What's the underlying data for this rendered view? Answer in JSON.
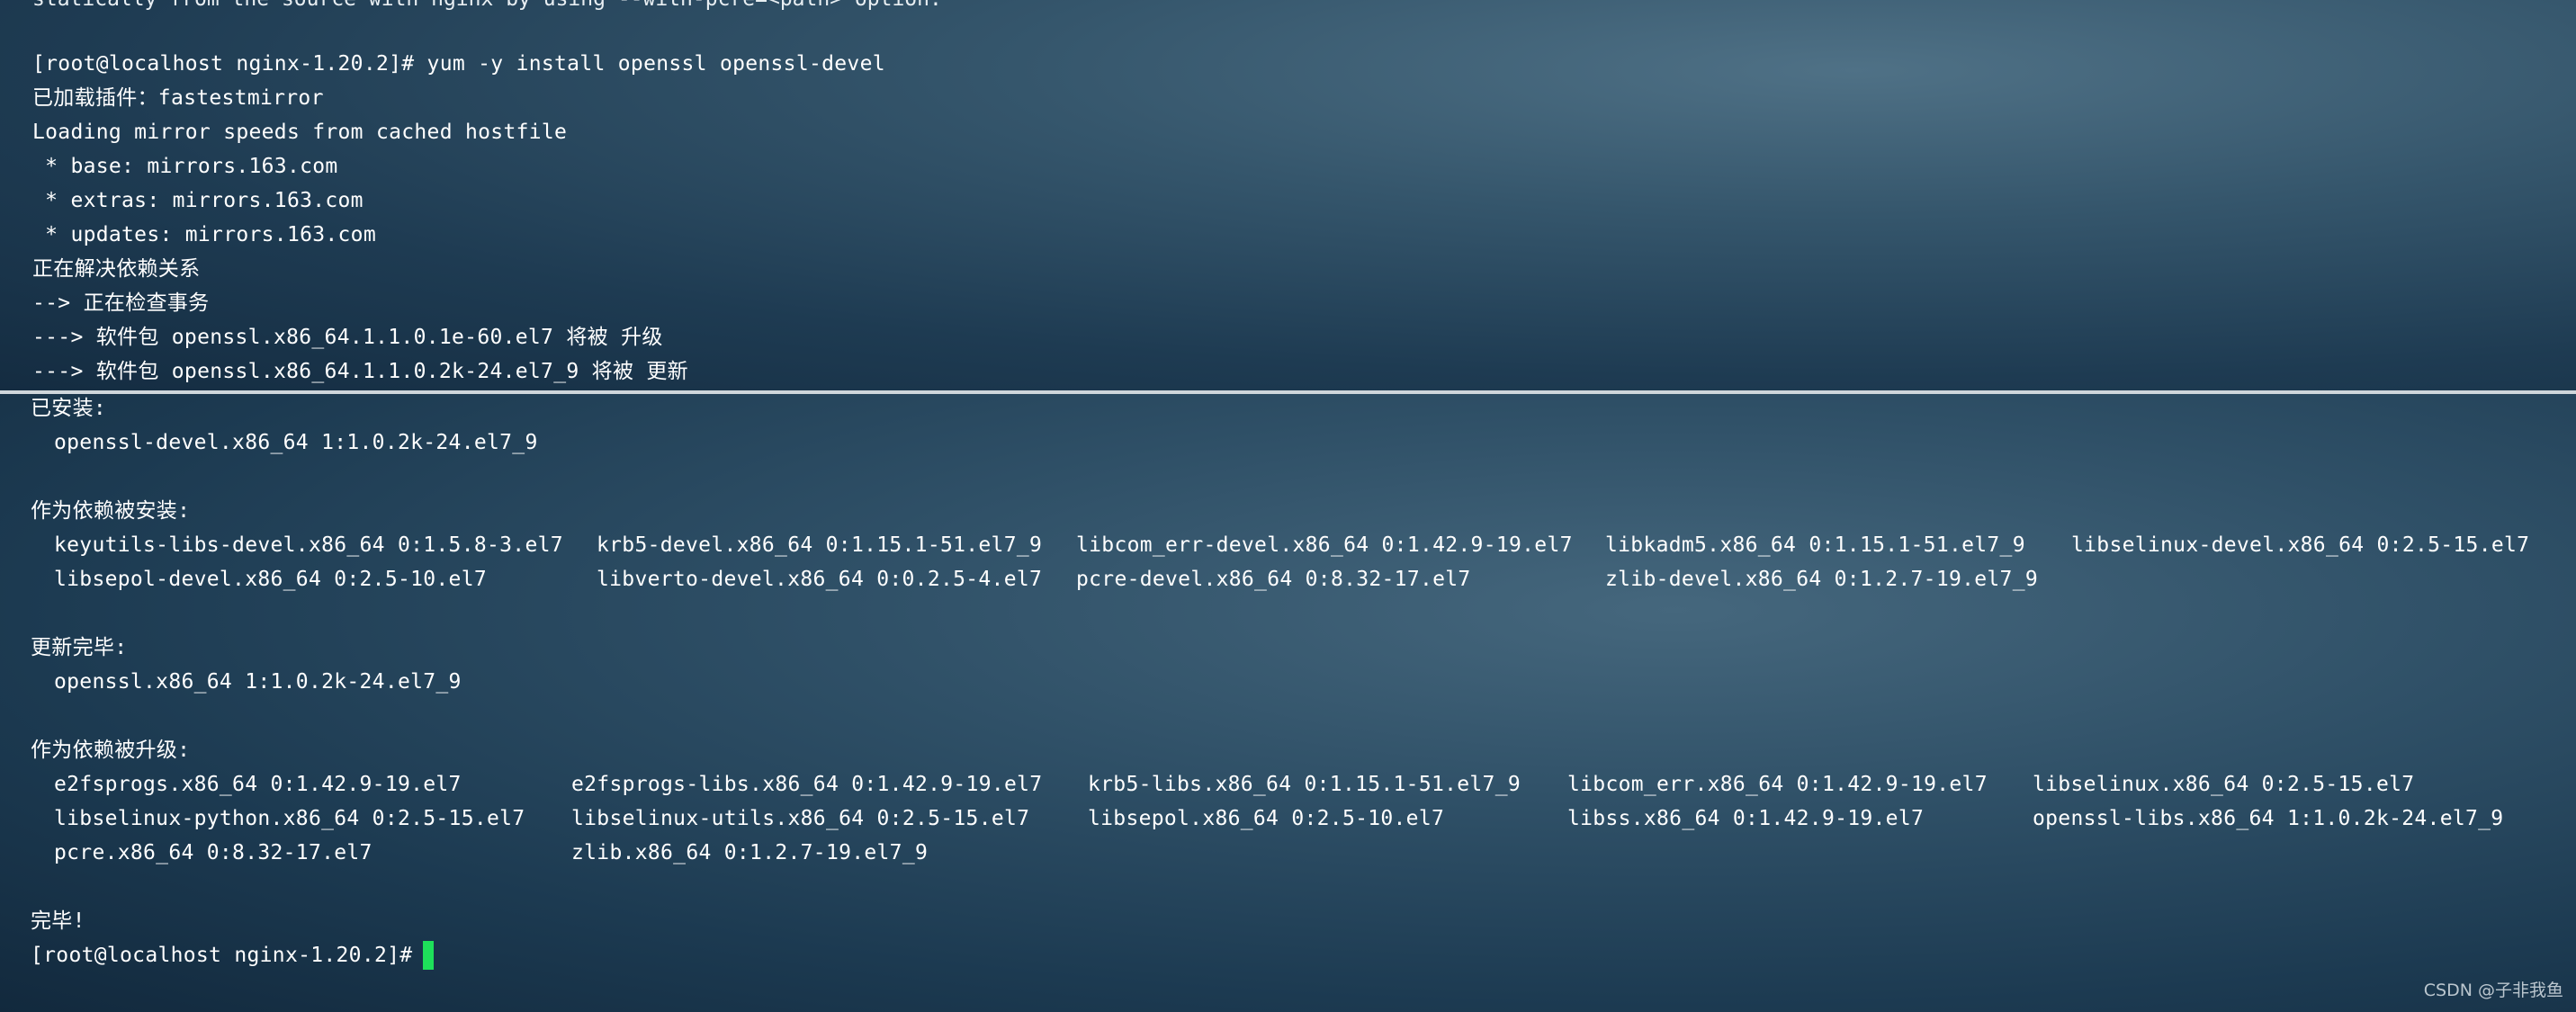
{
  "top_section": {
    "cut_line": "statically from the source with nginx by using --with-pcre=<path> option.",
    "lines": [
      "[root@localhost nginx-1.20.2]# yum -y install openssl openssl-devel",
      "已加载插件：fastestmirror",
      "Loading mirror speeds from cached hostfile",
      " * base: mirrors.163.com",
      " * extras: mirrors.163.com",
      " * updates: mirrors.163.com",
      "正在解决依赖关系",
      "--> 正在检查事务",
      "---> 软件包 openssl.x86_64.1.1.0.1e-60.el7 将被 升级",
      "---> 软件包 openssl.x86_64.1.1.0.2k-24.el7_9 将被 更新"
    ]
  },
  "bottom_section": {
    "installed_heading": "已安装:",
    "installed_items": [
      "openssl-devel.x86_64 1:1.0.2k-24.el7_9"
    ],
    "dep_installed_heading": "作为依赖被安装:",
    "dep_installed_rows": [
      [
        "keyutils-libs-devel.x86_64 0:1.5.8-3.el7",
        "krb5-devel.x86_64 0:1.15.1-51.el7_9",
        "libcom_err-devel.x86_64 0:1.42.9-19.el7",
        "libkadm5.x86_64 0:1.15.1-51.el7_9",
        "libselinux-devel.x86_64 0:2.5-15.el7"
      ],
      [
        "libsepol-devel.x86_64 0:2.5-10.el7",
        "libverto-devel.x86_64 0:0.2.5-4.el7",
        "pcre-devel.x86_64 0:8.32-17.el7",
        "zlib-devel.x86_64 0:1.2.7-19.el7_9",
        ""
      ]
    ],
    "updated_heading": "更新完毕:",
    "updated_items": [
      "openssl.x86_64 1:1.0.2k-24.el7_9"
    ],
    "dep_upgraded_heading": "作为依赖被升级:",
    "dep_upgraded_rows": [
      [
        "e2fsprogs.x86_64 0:1.42.9-19.el7",
        "e2fsprogs-libs.x86_64 0:1.42.9-19.el7",
        "krb5-libs.x86_64 0:1.15.1-51.el7_9",
        "libcom_err.x86_64 0:1.42.9-19.el7",
        "libselinux.x86_64 0:2.5-15.el7"
      ],
      [
        "libselinux-python.x86_64 0:2.5-15.el7",
        "libselinux-utils.x86_64 0:2.5-15.el7",
        "libsepol.x86_64 0:2.5-10.el7",
        "libss.x86_64 0:1.42.9-19.el7",
        "openssl-libs.x86_64 1:1.0.2k-24.el7_9"
      ],
      [
        "pcre.x86_64 0:8.32-17.el7",
        "zlib.x86_64 0:1.2.7-19.el7_9",
        "",
        "",
        ""
      ]
    ],
    "done_text": "完毕!",
    "prompt": "[root@localhost nginx-1.20.2]#"
  },
  "watermark": "CSDN @子非我鱼",
  "colors": {
    "terminal_bg": "#2a4a60",
    "text": "#ffffff",
    "cursor": "#1ee05a"
  }
}
